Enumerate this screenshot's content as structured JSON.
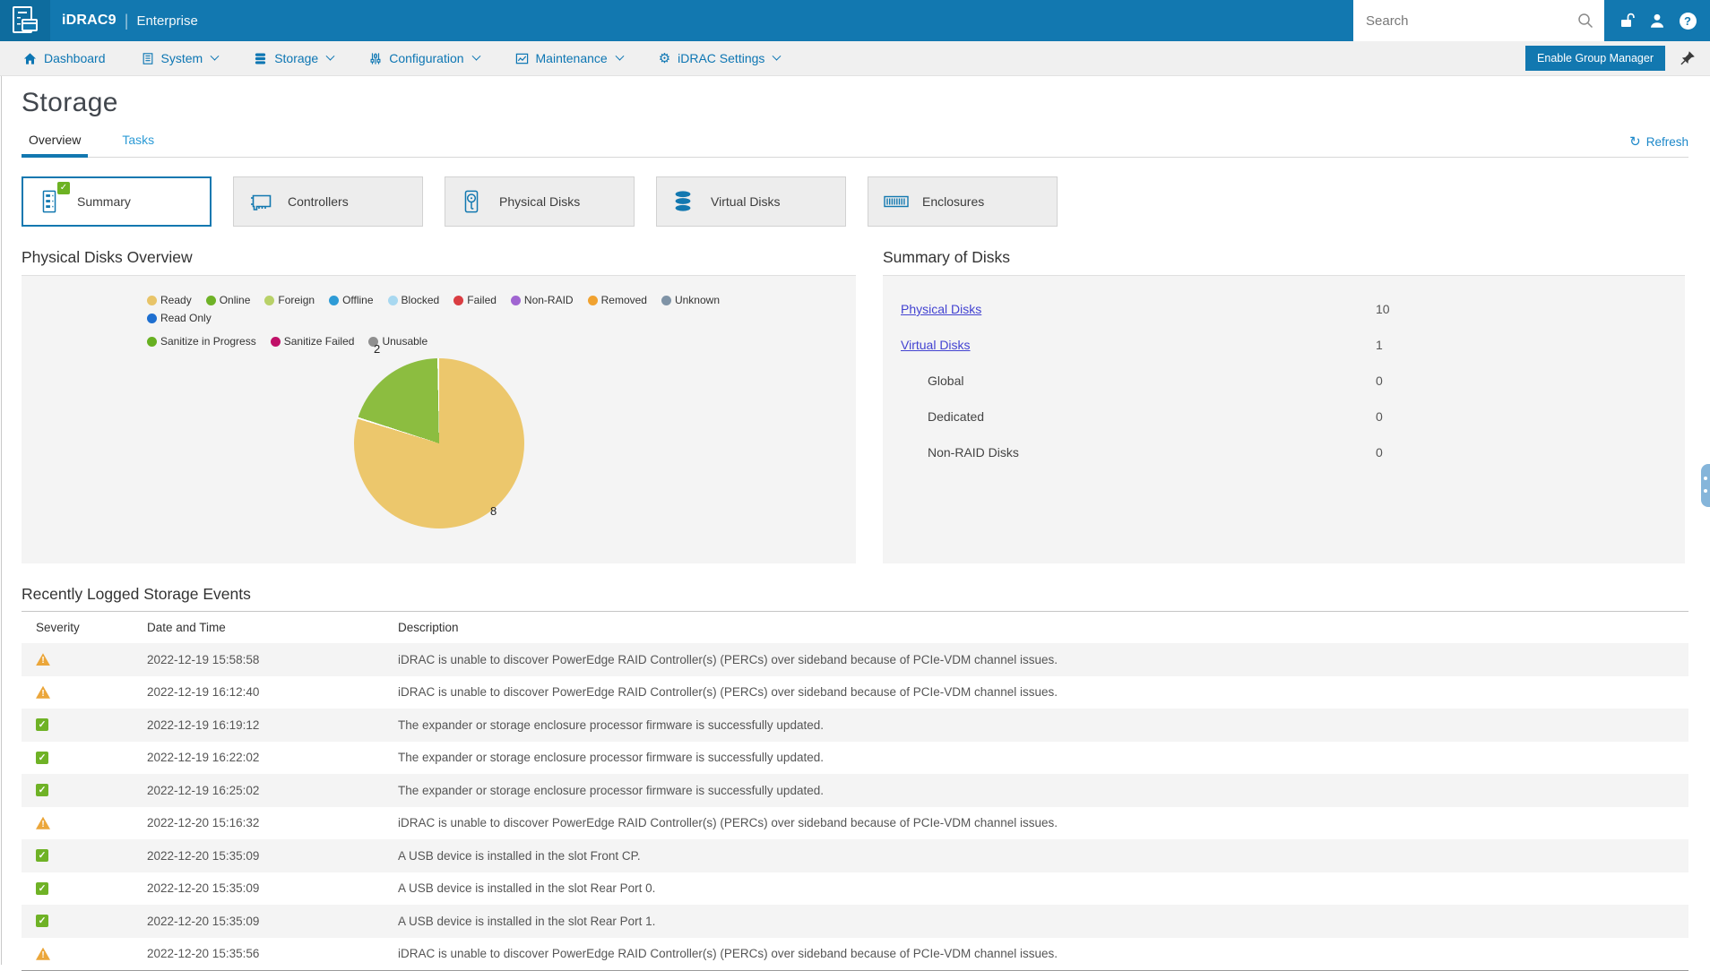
{
  "header": {
    "product": "iDRAC9",
    "edition": "Enterprise",
    "search_placeholder": "Search",
    "icons": [
      "search-icon",
      "unlock-icon",
      "user-icon",
      "help-icon"
    ]
  },
  "nav": {
    "items": [
      {
        "label": "Dashboard",
        "icon": "home",
        "has_dropdown": false
      },
      {
        "label": "System",
        "icon": "system",
        "has_dropdown": true
      },
      {
        "label": "Storage",
        "icon": "storage",
        "has_dropdown": true
      },
      {
        "label": "Configuration",
        "icon": "configuration",
        "has_dropdown": true
      },
      {
        "label": "Maintenance",
        "icon": "maintenance",
        "has_dropdown": true
      },
      {
        "label": "iDRAC Settings",
        "icon": "gear",
        "has_dropdown": true
      }
    ],
    "enable_group_manager_label": "Enable Group Manager",
    "pin_icon": "pushpin-icon"
  },
  "page": {
    "title": "Storage",
    "tabs": [
      {
        "label": "Overview",
        "active": true
      },
      {
        "label": "Tasks",
        "active": false
      }
    ],
    "refresh_label": "Refresh"
  },
  "cards": [
    {
      "label": "Summary",
      "icon": "summary-server",
      "active": true,
      "badge": "check"
    },
    {
      "label": "Controllers",
      "icon": "controller-card",
      "active": false
    },
    {
      "label": "Physical Disks",
      "icon": "physical-disk",
      "active": false
    },
    {
      "label": "Virtual Disks",
      "icon": "virtual-disks",
      "active": false
    },
    {
      "label": "Enclosures",
      "icon": "enclosure",
      "active": false
    }
  ],
  "overview_panel": {
    "title": "Physical Disks Overview"
  },
  "chart_data": {
    "type": "pie",
    "title": "Physical Disks Overview",
    "labels": [
      "Ready",
      "Online"
    ],
    "values": [
      8,
      2
    ],
    "slice_colors": [
      "#ecc76c",
      "#8cbd40"
    ],
    "data_labels": [
      "8",
      "2"
    ],
    "legend_position": "top",
    "legend_break_after_index": 9,
    "legend": [
      {
        "label": "Ready",
        "color": "#e8c468"
      },
      {
        "label": "Online",
        "color": "#6fb227"
      },
      {
        "label": "Foreign",
        "color": "#b8d168"
      },
      {
        "label": "Offline",
        "color": "#2e9bd6"
      },
      {
        "label": "Blocked",
        "color": "#a8d8f0"
      },
      {
        "label": "Failed",
        "color": "#da3d42"
      },
      {
        "label": "Non-RAID",
        "color": "#a065d1"
      },
      {
        "label": "Removed",
        "color": "#f0a230"
      },
      {
        "label": "Unknown",
        "color": "#7f93a6"
      },
      {
        "label": "Read Only",
        "color": "#1e6fd0"
      },
      {
        "label": "Sanitize in Progress",
        "color": "#67b021"
      },
      {
        "label": "Sanitize Failed",
        "color": "#c01068"
      },
      {
        "label": "Unusable",
        "color": "#8f8f8f"
      }
    ]
  },
  "summary_panel": {
    "title": "Summary of Disks",
    "rows": [
      {
        "label": "Physical Disks",
        "value": "10",
        "link": true,
        "indent": false
      },
      {
        "label": "Virtual Disks",
        "value": "1",
        "link": true,
        "indent": false
      },
      {
        "label": "Global",
        "value": "0",
        "link": false,
        "indent": true
      },
      {
        "label": "Dedicated",
        "value": "0",
        "link": false,
        "indent": true
      },
      {
        "label": "Non-RAID Disks",
        "value": "0",
        "link": false,
        "indent": true
      }
    ]
  },
  "events": {
    "title": "Recently Logged Storage Events",
    "columns": [
      "Severity",
      "Date and Time",
      "Description"
    ],
    "rows": [
      {
        "severity": "warning",
        "datetime": "2022-12-19 15:58:58",
        "description": "iDRAC is unable to discover PowerEdge RAID Controller(s) (PERCs) over sideband because of PCIe-VDM channel issues."
      },
      {
        "severity": "warning",
        "datetime": "2022-12-19 16:12:40",
        "description": "iDRAC is unable to discover PowerEdge RAID Controller(s) (PERCs) over sideband because of PCIe-VDM channel issues."
      },
      {
        "severity": "ok",
        "datetime": "2022-12-19 16:19:12",
        "description": "The expander or storage enclosure processor firmware is successfully updated."
      },
      {
        "severity": "ok",
        "datetime": "2022-12-19 16:22:02",
        "description": "The expander or storage enclosure processor firmware is successfully updated."
      },
      {
        "severity": "ok",
        "datetime": "2022-12-19 16:25:02",
        "description": "The expander or storage enclosure processor firmware is successfully updated."
      },
      {
        "severity": "warning",
        "datetime": "2022-12-20 15:16:32",
        "description": "iDRAC is unable to discover PowerEdge RAID Controller(s) (PERCs) over sideband because of PCIe-VDM channel issues."
      },
      {
        "severity": "ok",
        "datetime": "2022-12-20 15:35:09",
        "description": "A USB device is installed in the slot Front CP."
      },
      {
        "severity": "ok",
        "datetime": "2022-12-20 15:35:09",
        "description": "A USB device is installed in the slot Rear Port 0."
      },
      {
        "severity": "ok",
        "datetime": "2022-12-20 15:35:09",
        "description": "A USB device is installed in the slot Rear Port 1."
      },
      {
        "severity": "warning",
        "datetime": "2022-12-20 15:35:56",
        "description": "iDRAC is unable to discover PowerEdge RAID Controller(s) (PERCs) over sideband because of PCIe-VDM channel issues."
      }
    ]
  },
  "colors": {
    "header_blue": "#1278b0",
    "logo_blue": "#0e6c9e",
    "nav_link_blue": "#0d76b3",
    "tab_link_blue": "#2d9bd6",
    "summary_link_indigo": "#4343d1",
    "warning_amber": "#eba63a",
    "success_green": "#6fb226",
    "panel_gray": "#f4f4f4"
  }
}
